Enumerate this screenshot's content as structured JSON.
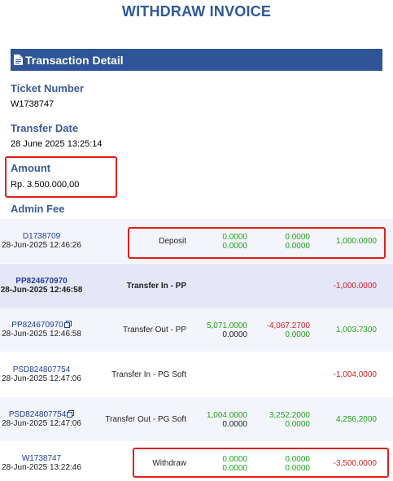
{
  "title": "WITHDRAW INVOICE",
  "section": {
    "title": "Transaction Detail",
    "icon": "document-icon"
  },
  "fields": {
    "ticket_label": "Ticket Number",
    "ticket_value": "W1738747",
    "date_label": "Transfer Date",
    "date_value": "28 June 2025 13:25:14",
    "amount_label": "Amount",
    "amount_value": "Rp. 3.500.000,00",
    "fee_label": "Admin Fee"
  },
  "colors": {
    "header_blue": "#2d5597",
    "label_blue": "#3a5d96",
    "positive": "#19a619",
    "negative": "#d42020",
    "highlight": "#e02020"
  },
  "transactions": [
    {
      "id": "D1738709",
      "date": "28-Jun-2025 12:46:26",
      "type": "Deposit",
      "a1": "0.0000",
      "a2": "0.0000",
      "b1": "0.0000",
      "b2": "0.0000",
      "balance": "1,000.0000",
      "copy_icon": false,
      "highlighted": true
    },
    {
      "id": "PP824670970",
      "date": "28-Jun-2025 12:46:58",
      "type": "Transfer In - PP",
      "a1": "",
      "a2": "",
      "b1": "",
      "b2": "",
      "balance": "-1,000.0000",
      "copy_icon": false,
      "highlighted": false
    },
    {
      "id": "PP824670970",
      "date": "28-Jun-2025 12:46:58",
      "type": "Transfer Out - PP",
      "a1": "5,071.0000",
      "a2": "0.0000",
      "b1": "-4,067.2700",
      "b2": "0.0000",
      "balance": "1,003.7300",
      "copy_icon": true,
      "highlighted": false
    },
    {
      "id": "PSD824807754",
      "date": "28-Jun-2025 12:47:06",
      "type": "Transfer In - PG Soft",
      "a1": "",
      "a2": "",
      "b1": "",
      "b2": "",
      "balance": "-1,004.0000",
      "copy_icon": false,
      "highlighted": false
    },
    {
      "id": "PSD824807754",
      "date": "28-Jun-2025 12:47:06",
      "type": "Transfer Out - PG Soft",
      "a1": "1,004.0000",
      "a2": "0.0000",
      "b1": "3,252.2000",
      "b2": "0.0000",
      "balance": "4,256.2000",
      "copy_icon": true,
      "highlighted": false
    },
    {
      "id": "W1738747",
      "date": "28-Jun-2025 13:22:46",
      "type": "Withdraw",
      "a1": "0.0000",
      "a2": "0.0000",
      "b1": "0.0000",
      "b2": "0.0000",
      "balance": "-3,500.0000",
      "copy_icon": false,
      "highlighted": true
    }
  ]
}
